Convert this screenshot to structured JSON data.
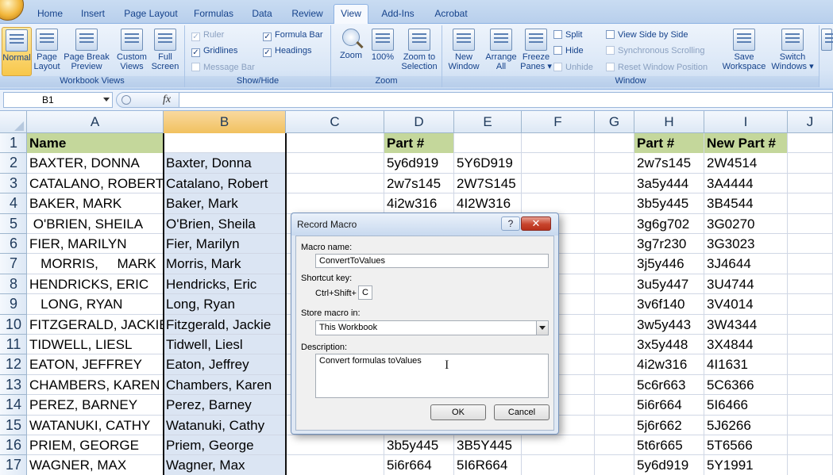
{
  "ribbon": {
    "tabs": [
      "Home",
      "Insert",
      "Page Layout",
      "Formulas",
      "Data",
      "Review",
      "View",
      "Add-Ins",
      "Acrobat"
    ],
    "active_tab": "View",
    "groups": {
      "workbook_views": {
        "label": "Workbook Views",
        "buttons": [
          {
            "line1": "Normal",
            "line2": ""
          },
          {
            "line1": "Page",
            "line2": "Layout"
          },
          {
            "line1": "Page Break",
            "line2": "Preview"
          },
          {
            "line1": "Custom",
            "line2": "Views"
          },
          {
            "line1": "Full",
            "line2": "Screen"
          }
        ]
      },
      "show_hide": {
        "label": "Show/Hide",
        "items": [
          {
            "label": "Ruler",
            "checked": true,
            "disabled": true
          },
          {
            "label": "Gridlines",
            "checked": true,
            "disabled": false
          },
          {
            "label": "Message Bar",
            "checked": false,
            "disabled": true
          },
          {
            "label": "Formula Bar",
            "checked": true,
            "disabled": false
          },
          {
            "label": "Headings",
            "checked": true,
            "disabled": false
          }
        ]
      },
      "zoom": {
        "label": "Zoom",
        "buttons": [
          {
            "line1": "Zoom",
            "line2": ""
          },
          {
            "line1": "100%",
            "line2": ""
          },
          {
            "line1": "Zoom to",
            "line2": "Selection"
          }
        ]
      },
      "window": {
        "label": "Window",
        "buttons": [
          {
            "line1": "New",
            "line2": "Window"
          },
          {
            "line1": "Arrange",
            "line2": "All"
          },
          {
            "line1": "Freeze",
            "line2": "Panes ▾"
          },
          {
            "line1": "Save",
            "line2": "Workspace"
          },
          {
            "line1": "Switch",
            "line2": "Windows ▾"
          }
        ],
        "small": [
          "Split",
          "Hide",
          "Unhide",
          "View Side by Side",
          "Synchronous Scrolling",
          "Reset Window Position"
        ]
      }
    },
    "check_mark": "✓"
  },
  "formula_bar": {
    "name_box": "B1",
    "fx": "fx",
    "value": ""
  },
  "grid": {
    "columns": [
      {
        "letter": "A",
        "width": 172
      },
      {
        "letter": "B",
        "width": 154
      },
      {
        "letter": "C",
        "width": 124
      },
      {
        "letter": "D",
        "width": 88
      },
      {
        "letter": "E",
        "width": 85
      },
      {
        "letter": "F",
        "width": 92
      },
      {
        "letter": "G",
        "width": 50
      },
      {
        "letter": "H",
        "width": 88
      },
      {
        "letter": "I",
        "width": 105
      },
      {
        "letter": "J",
        "width": 57
      }
    ],
    "selected_column": "B",
    "rows": [
      {
        "n": "1",
        "A": "Name",
        "B": "",
        "D": "Part #",
        "E": "",
        "H": "Part #",
        "I": "New Part #"
      },
      {
        "n": "2",
        "A": "BAXTER, DONNA",
        "B": "Baxter, Donna",
        "D": "5y6d919",
        "E": "5Y6D919",
        "H": "2w7s145",
        "I": "2W4514"
      },
      {
        "n": "3",
        "A": "CATALANO, ROBERT",
        "B": "Catalano, Robert",
        "D": "2w7s145",
        "E": "2W7S145",
        "H": "3a5y444",
        "I": "3A4444"
      },
      {
        "n": "4",
        "A": "BAKER, MARK",
        "B": "Baker, Mark",
        "D": "4i2w316",
        "E": "4I2W316",
        "H": "3b5y445",
        "I": "3B4544"
      },
      {
        "n": "5",
        "A": " O'BRIEN, SHEILA",
        "B": "O'Brien, Sheila",
        "D": "",
        "E": "",
        "H": "3g6g702",
        "I": "3G0270"
      },
      {
        "n": "6",
        "A": "FIER, MARILYN",
        "B": "Fier, Marilyn",
        "D": "",
        "E": "",
        "H": "3g7r230",
        "I": "3G3023"
      },
      {
        "n": "7",
        "A": "   MORRIS,     MARK",
        "B": "Morris, Mark",
        "D": "",
        "E": "",
        "H": "3j5y446",
        "I": "3J4644"
      },
      {
        "n": "8",
        "A": "HENDRICKS, ERIC",
        "B": "Hendricks, Eric",
        "D": "",
        "E": "",
        "H": "3u5y447",
        "I": "3U4744"
      },
      {
        "n": "9",
        "A": "   LONG, RYAN",
        "B": "Long, Ryan",
        "D": "",
        "E": "",
        "H": "3v6f140",
        "I": "3V4014"
      },
      {
        "n": "10",
        "A": "FITZGERALD, JACKIE",
        "B": "Fitzgerald, Jackie",
        "D": "",
        "E": "",
        "H": "3w5y443",
        "I": "3W4344"
      },
      {
        "n": "11",
        "A": "TIDWELL, LIESL",
        "B": "Tidwell, Liesl",
        "D": "",
        "E": "",
        "H": "3x5y448",
        "I": "3X4844"
      },
      {
        "n": "12",
        "A": "EATON, JEFFREY",
        "B": "Eaton, Jeffrey",
        "D": "",
        "E": "",
        "H": "4i2w316",
        "I": "4I1631"
      },
      {
        "n": "13",
        "A": "CHAMBERS, KAREN",
        "B": "Chambers, Karen",
        "D": "",
        "E": "",
        "H": "5c6r663",
        "I": "5C6366"
      },
      {
        "n": "14",
        "A": "PEREZ, BARNEY",
        "B": "Perez, Barney",
        "D": "",
        "E": "",
        "H": "5i6r664",
        "I": "5I6466"
      },
      {
        "n": "15",
        "A": "WATANUKI, CATHY",
        "B": "Watanuki, Cathy",
        "D": "",
        "E": "",
        "H": "5j6r662",
        "I": "5J6266"
      },
      {
        "n": "16",
        "A": "PRIEM, GEORGE",
        "B": "Priem, George",
        "D": "3b5y445",
        "E": "3B5Y445",
        "H": "5t6r665",
        "I": "5T6566"
      },
      {
        "n": "17",
        "A": "WAGNER, MAX",
        "B": "Wagner, Max",
        "D": "5i6r664",
        "E": "5I6R664",
        "H": "5y6d919",
        "I": "5Y1991"
      }
    ],
    "header_fill": "#c4d79b"
  },
  "dialog": {
    "title": "Record Macro",
    "help": "?",
    "close": "✕",
    "macro_name_label": "Macro name:",
    "macro_name_value": "ConvertToValues",
    "shortcut_label": "Shortcut key:",
    "shortcut_prefix": "Ctrl+Shift+",
    "shortcut_value": "C",
    "store_label": "Store macro in:",
    "store_value": "This Workbook",
    "description_label": "Description:",
    "description_value": "Convert formulas toValues",
    "ok": "OK",
    "cancel": "Cancel"
  }
}
